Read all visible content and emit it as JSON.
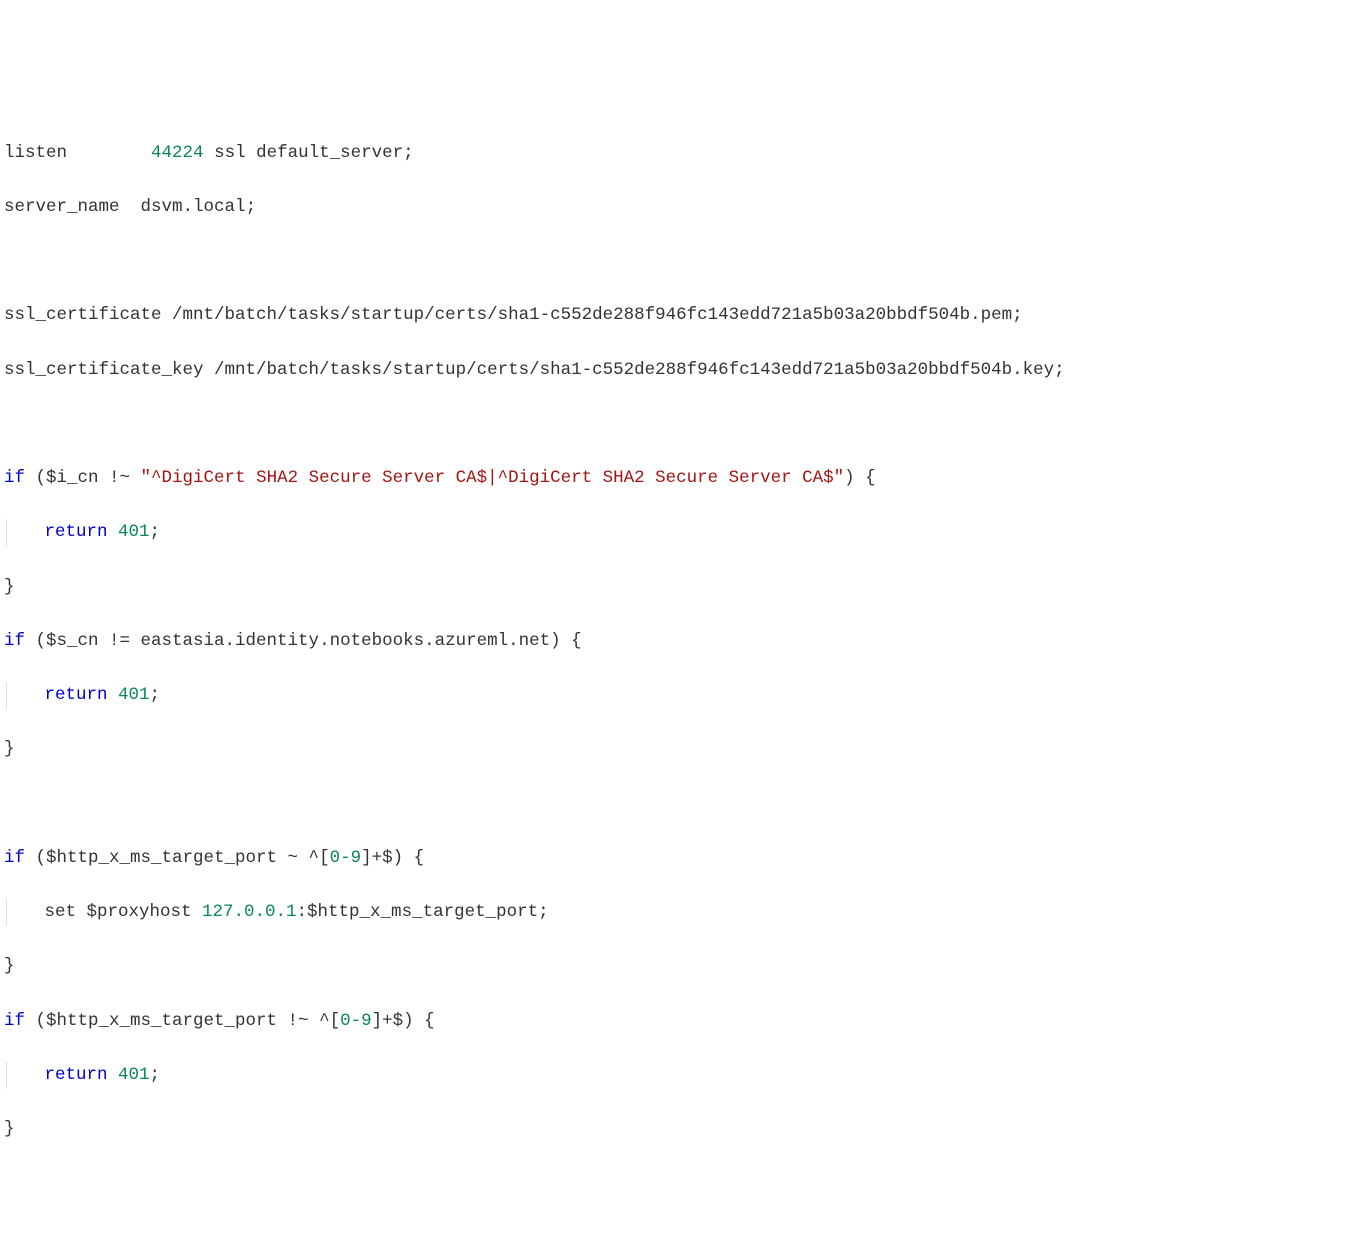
{
  "code": {
    "l1_listen": "listen",
    "l1_port": "44224",
    "l1_ssl": "ssl",
    "l1_default": "default_server;",
    "l2_server_name": "server_name",
    "l2_value": "dsvm.local;",
    "l4_cert": "ssl_certificate /mnt/batch/tasks/startup/certs/sha1-c552de288f946fc143edd721a5b03a20bbdf504b.pem;",
    "l5_key": "ssl_certificate_key /mnt/batch/tasks/startup/certs/sha1-c552de288f946fc143edd721a5b03a20bbdf504b.key;",
    "l7_if": "if",
    "l7_open": " ($i_cn !~ ",
    "l7_str": "\"^DigiCert SHA2 Secure Server CA$|^DigiCert SHA2 Secure Server CA$\"",
    "l7_close": ") {",
    "l8_return": "return",
    "l8_code": " 401",
    "l8_semi": ";",
    "l9_close": "}",
    "l10_if": "if",
    "l10_cond": " ($s_cn != eastasia.identity.notebooks.azureml.net) {",
    "l11_return": "return",
    "l11_code": " 401",
    "l11_semi": ";",
    "l12_close": "}",
    "l14_if": "if",
    "l14_cond_a": " ($http_x_ms_target_port ~ ^[",
    "l14_num": "0-9",
    "l14_cond_b": "]+$) {",
    "l15_set": "set $proxyhost ",
    "l15_ip": "127.0.0.1",
    "l15_rest": ":$http_x_ms_target_port;",
    "l16_close": "}",
    "l17_if": "if",
    "l17_cond_a": " ($http_x_ms_target_port !~ ^[",
    "l17_num": "0-9",
    "l17_cond_b": "]+$) {",
    "l18_return": "return",
    "l18_code": " 401",
    "l18_semi": ";",
    "l19_close": "}"
  }
}
